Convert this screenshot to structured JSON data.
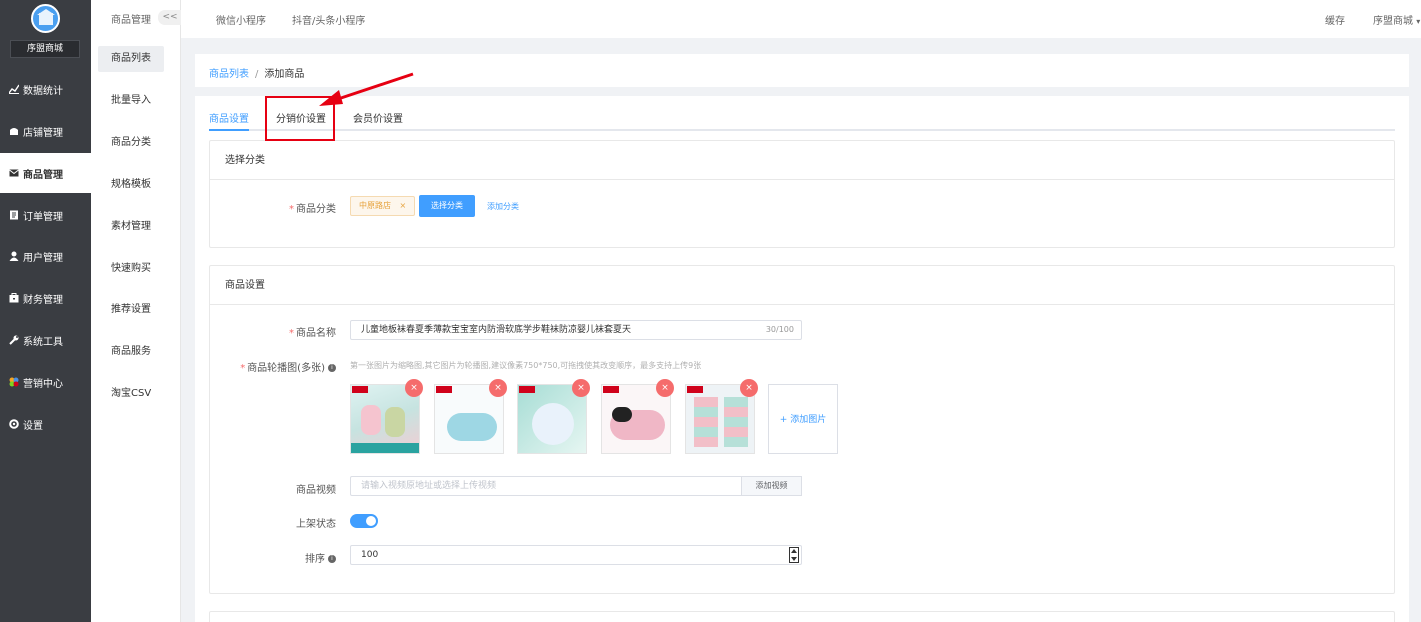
{
  "sidebar": {
    "shop_name": "序盟商城",
    "items": [
      {
        "label": "数据统计",
        "icon": "chart-icon"
      },
      {
        "label": "店铺管理",
        "icon": "shop-icon"
      },
      {
        "label": "商品管理",
        "icon": "goods-icon"
      },
      {
        "label": "订单管理",
        "icon": "order-icon"
      },
      {
        "label": "用户管理",
        "icon": "user-icon"
      },
      {
        "label": "财务管理",
        "icon": "finance-icon"
      },
      {
        "label": "系统工具",
        "icon": "wrench-icon"
      },
      {
        "label": "营销中心",
        "icon": "marketing-icon"
      },
      {
        "label": "设置",
        "icon": "gear-icon"
      }
    ]
  },
  "submenu": {
    "title": "商品管理",
    "collapse": "<<",
    "items": [
      "商品列表",
      "批量导入",
      "商品分类",
      "规格模板",
      "素材管理",
      "快速购买",
      "推荐设置",
      "商品服务",
      "淘宝CSV"
    ]
  },
  "topbar": {
    "mini_wechat": "微信小程序",
    "mini_douyin": "抖音/头条小程序",
    "cache": "缓存",
    "user": "序盟商城"
  },
  "breadcrumb": {
    "parent": "商品列表",
    "separator": "/",
    "current": "添加商品"
  },
  "tabs": [
    "商品设置",
    "分销价设置",
    "会员价设置"
  ],
  "category_section": {
    "title": "选择分类",
    "label": "商品分类",
    "tag": "中原路店",
    "select_btn": "选择分类",
    "add_link": "添加分类"
  },
  "goods_section": {
    "title": "商品设置",
    "name_label": "商品名称",
    "name_value": "儿童地板袜春夏季薄款宝宝室内防滑软底学步鞋袜防凉婴儿袜套夏天",
    "name_count": "30/100",
    "carousel_label": "商品轮播图(多张)",
    "carousel_hint": "第一张图片为缩略图,其它图片为轮播图,建议像素750*750,可拖拽使其改变顺序，最多支持上传9张",
    "add_image": "+ 添加图片",
    "video_label": "商品视频",
    "video_placeholder": "请输入视频原地址或选择上传视频",
    "video_btn": "添加视频",
    "status_label": "上架状态",
    "status_on": true,
    "sort_label": "排序",
    "sort_value": "100"
  },
  "colors": {
    "accent": "#409eff",
    "danger": "#f56c6c",
    "sidebar": "#3a3d42",
    "annotation": "#e60012"
  }
}
